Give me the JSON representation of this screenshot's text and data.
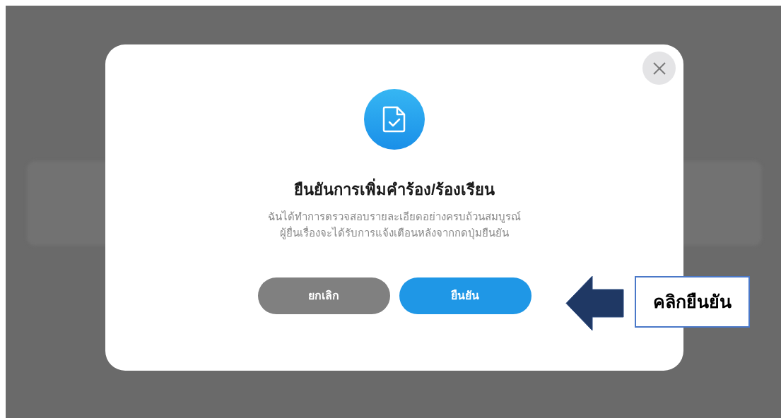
{
  "dialog": {
    "title": "ยืนยันการเพิ่มคำร้อง/ร้องเรียน",
    "message": [
      "ฉันได้ทำการตรวจสอบรายละเอียดอย่างครบถ้วนสมบูรณ์",
      "ผู้ยื่นเรื่องจะได้รับการแจ้งเตือนหลังจากกดปุ่มยืนยัน"
    ],
    "buttons": [
      {
        "label": "ยกเลิก",
        "kind": "cancel"
      },
      {
        "label": "ยืนยัน",
        "kind": "confirm"
      }
    ]
  },
  "callout": {
    "text": "คลิกยืนยัน"
  }
}
